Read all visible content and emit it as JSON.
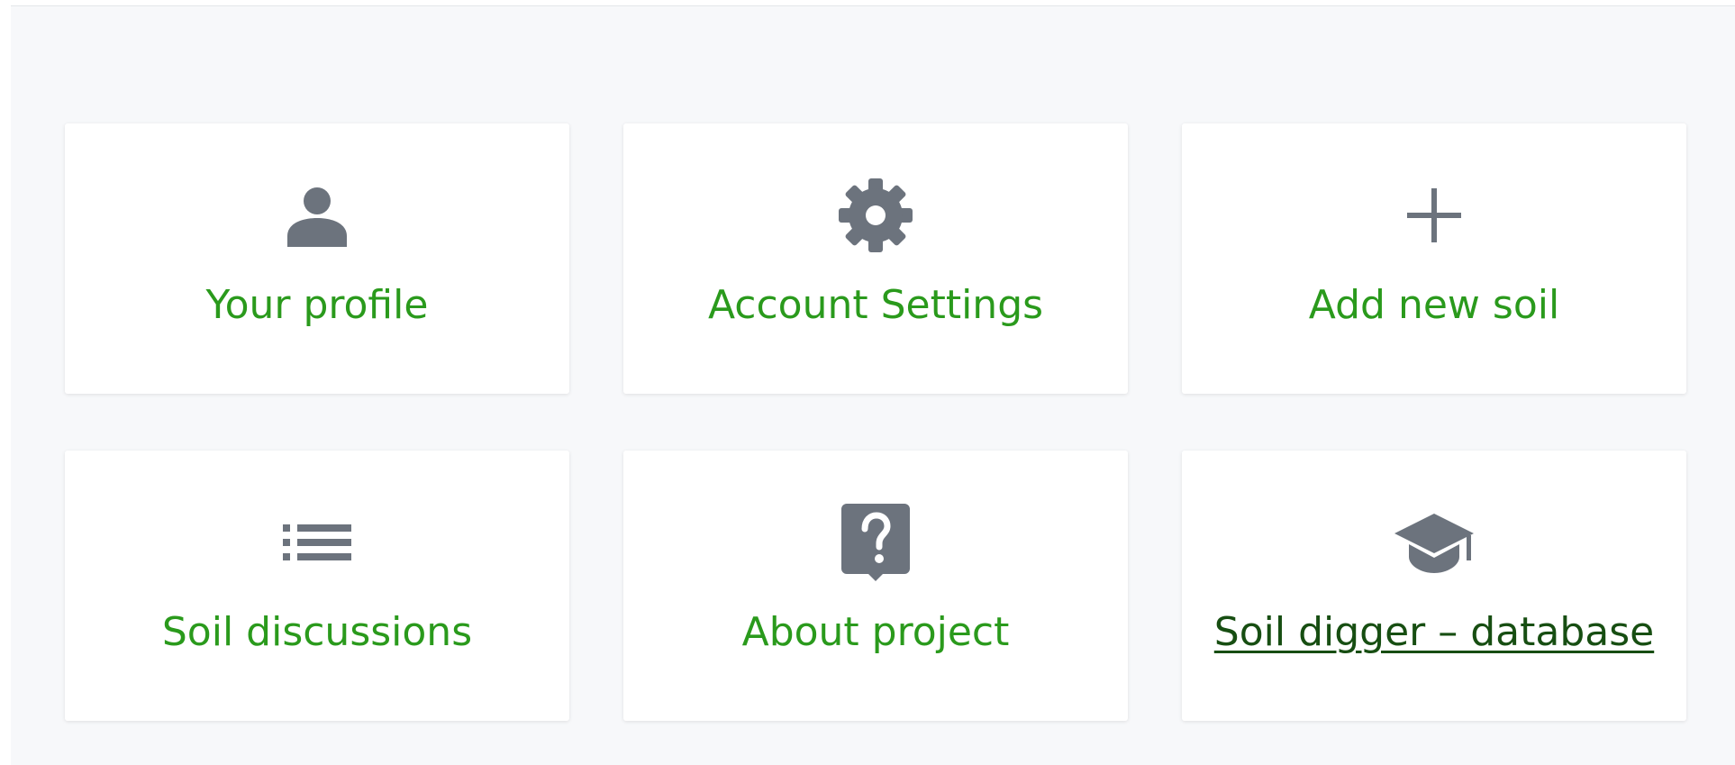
{
  "dashboard": {
    "tiles": [
      {
        "label": "Your profile",
        "icon": "person-icon"
      },
      {
        "label": "Account Settings",
        "icon": "gear-icon"
      },
      {
        "label": "Add new soil",
        "icon": "plus-icon"
      },
      {
        "label": "Soil discussions",
        "icon": "list-icon"
      },
      {
        "label": "About project",
        "icon": "question-icon"
      },
      {
        "label": "Soil digger – database",
        "icon": "graduation-cap-icon"
      }
    ]
  },
  "colors": {
    "page_background": "#f7f8fa",
    "card_background": "#ffffff",
    "icon": "#6c737d",
    "label_green": "#2a9a1c",
    "link_dark_green": "#174e12"
  }
}
